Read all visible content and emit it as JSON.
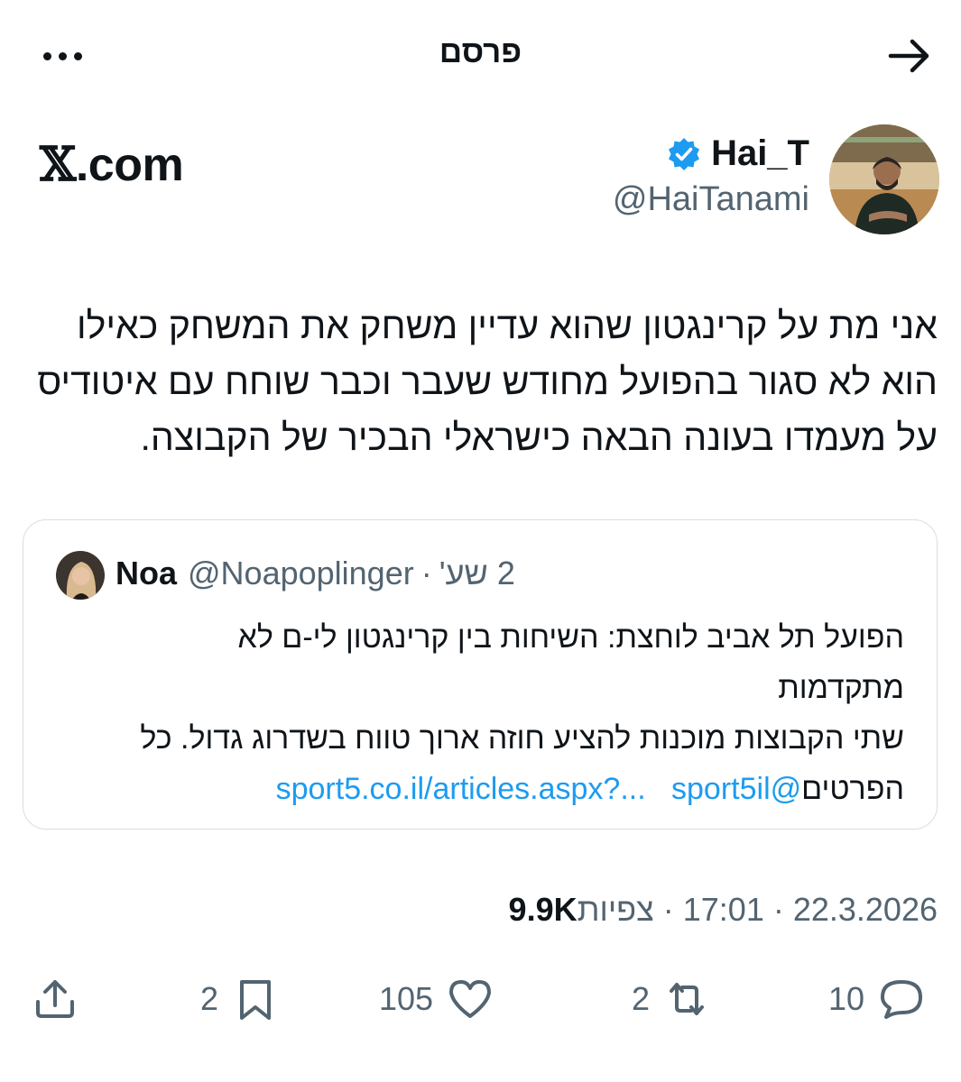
{
  "topbar": {
    "title": "פרסם",
    "more_icon": "more-horizontal-icon",
    "back_icon": "arrow-right-icon"
  },
  "header": {
    "site_mark_x": "𝕏",
    "site_mark_suffix": ".com",
    "display_name": "Hai_T",
    "handle": "@HaiTanami",
    "verified_icon": "verified-badge-icon"
  },
  "tweet": {
    "lines": [
      "אני מת על קרינגטון שהוא עדיין משחק את המשחק כאילו",
      "הוא לא סגור בהפועל מחודש שעבר וכבר שוחח עם איטודיס",
      "על מעמדו בעונה הבאה כישראלי הבכיר של הקבוצה."
    ]
  },
  "quote": {
    "name": "Noa",
    "handle": "@Noapoplinger",
    "separator": "·",
    "time": "2 שע'",
    "line1": "הפועל תל אביב לוחצת: השיחות בין קרינגטון לי-ם לא",
    "line2": "מתקדמות",
    "line3": "שתי הקבוצות מוכנות להציע חוזה ארוך טווח בשדרוג גדול. כל",
    "line4_text": "הפרטים",
    "mention": "@sport5il",
    "url": "sport5.co.il/articles.aspx?..."
  },
  "meta": {
    "date": "22.3.2026",
    "sep": "·",
    "time": "17:01",
    "views_label": "צפיות",
    "views_count": "9.9K"
  },
  "actions": {
    "replies": "10",
    "reposts": "2",
    "likes": "105",
    "bookmarks": "2"
  },
  "colors": {
    "accent": "#1d9bf0",
    "text": "#0f1419",
    "muted": "#536471",
    "border": "#d9dee2"
  }
}
